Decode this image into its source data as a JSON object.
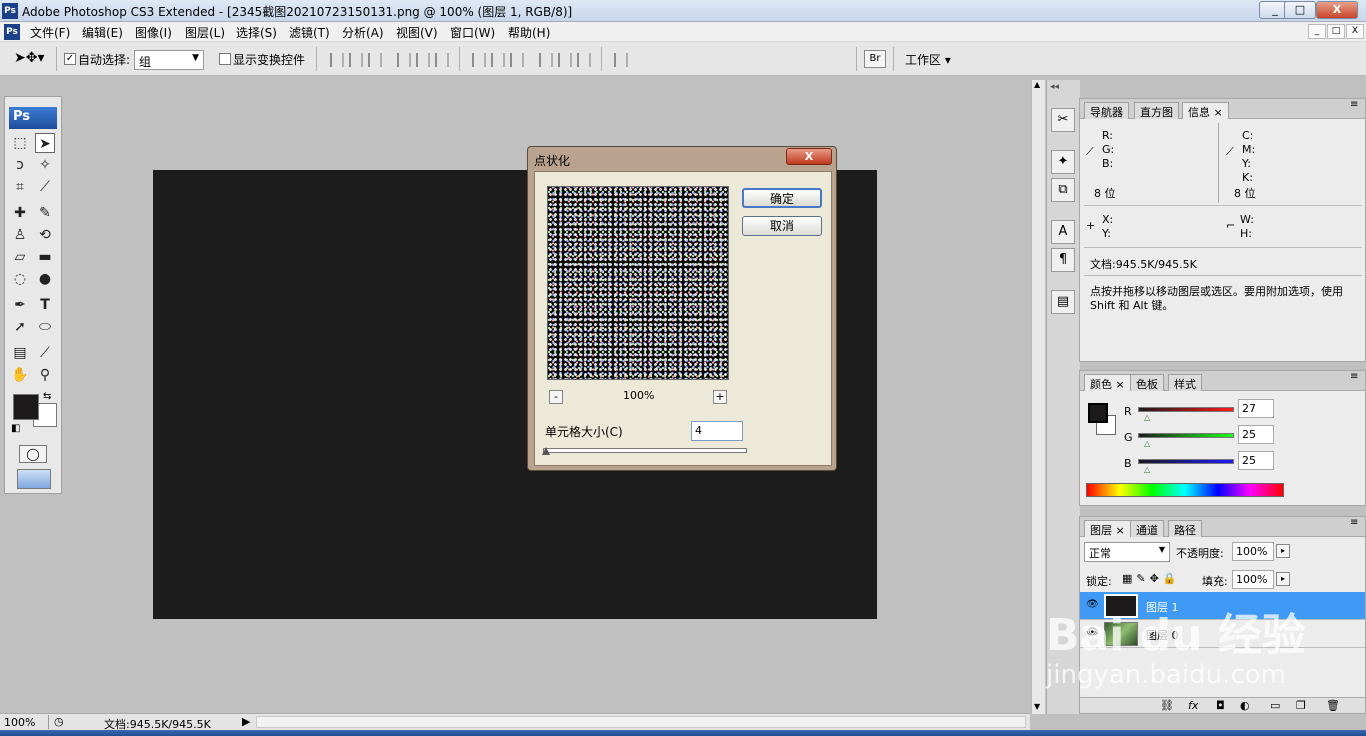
{
  "app": {
    "title": "Adobe Photoshop CS3 Extended - [2345截图20210723150131.png @ 100% (图层 1, RGB/8)]",
    "logo": "Ps"
  },
  "window_controls": {
    "minimize": "_",
    "restore": "□",
    "close": "X"
  },
  "menubar": {
    "items": [
      "文件(F)",
      "编辑(E)",
      "图像(I)",
      "图层(L)",
      "选择(S)",
      "滤镜(T)",
      "分析(A)",
      "视图(V)",
      "窗口(W)",
      "帮助(H)"
    ],
    "mdi": [
      "_",
      "□",
      "X"
    ]
  },
  "options": {
    "auto_select_checked": true,
    "auto_select_label": "自动选择:",
    "auto_select_value": "组",
    "show_transform_checked": false,
    "show_transform_label": "显示变换控件",
    "workspace_label": "工作区"
  },
  "toolbox": {
    "logo": "Ps"
  },
  "dialog": {
    "title": "点状化",
    "close": "X",
    "ok_label": "确定",
    "cancel_label": "取消",
    "zoom_out": "-",
    "zoom_in": "+",
    "zoom_value": "100%",
    "cell_size_label": "单元格大小(C)",
    "cell_size_value": "4"
  },
  "info_panel": {
    "tabs": [
      {
        "label": "导航器"
      },
      {
        "label": "直方图"
      },
      {
        "label": "信息"
      }
    ],
    "active_close": "×",
    "r": "R:",
    "g": "G:",
    "b": "B:",
    "c": "C:",
    "m": "M:",
    "y": "Y:",
    "k": "K:",
    "bits_left": "8 位",
    "bits_right": "8 位",
    "x": "X:",
    "yy": "Y:",
    "w": "W:",
    "h": "H:",
    "doc": "文档:945.5K/945.5K",
    "hint": "点按并拖移以移动图层或选区。要用附加选项，使用 Shift 和 Alt 键。"
  },
  "color_panel": {
    "tabs": [
      {
        "label": "颜色"
      },
      {
        "label": "色板"
      },
      {
        "label": "样式"
      }
    ],
    "active_close": "×",
    "r_label": "R",
    "g_label": "G",
    "b_label": "B",
    "r_value": "27",
    "g_value": "25",
    "b_value": "25",
    "r": 27,
    "g": 25,
    "b": 25,
    "foreground": "#1b1919"
  },
  "layers_panel": {
    "tabs": [
      {
        "label": "图层"
      },
      {
        "label": "通道"
      },
      {
        "label": "路径"
      }
    ],
    "active_close": "×",
    "blend_mode": "正常",
    "opacity_label": "不透明度:",
    "opacity_value": "100%",
    "lock_label": "锁定:",
    "fill_label": "填充:",
    "fill_value": "100%",
    "layers": [
      {
        "name": "图层 1",
        "selected": true
      },
      {
        "name": "图层 0",
        "selected": false
      }
    ]
  },
  "status": {
    "zoom": "100%",
    "doc": "文档:945.5K/945.5K"
  },
  "watermark": {
    "brand": "Bai du 经验",
    "url": "jingyan.baidu.com"
  }
}
